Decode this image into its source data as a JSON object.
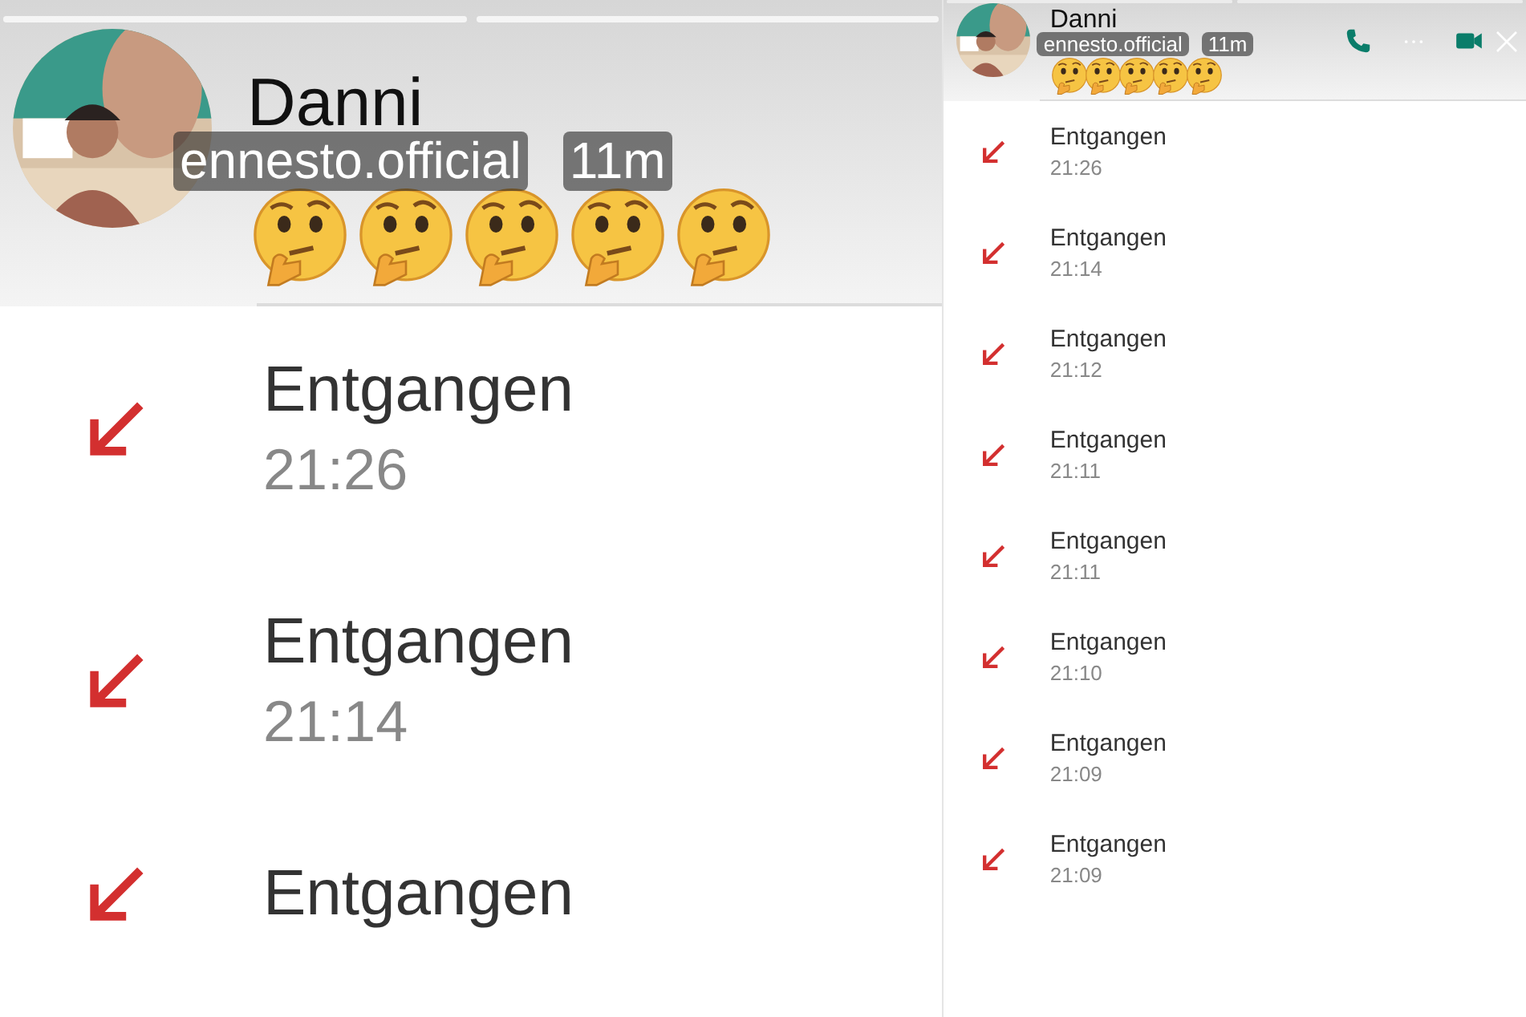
{
  "panels": [
    {
      "kind": "zoomed",
      "story_bars": [
        {
          "level": 1
        },
        {
          "level": 1
        }
      ],
      "header": {
        "name": "Danni",
        "account": "ennesto.official",
        "time_ago": "11m"
      },
      "calls": [
        {
          "label": "Entgangen",
          "time": "21:26"
        },
        {
          "label": "Entgangen",
          "time": "21:14"
        },
        {
          "label": "Entgangen"
        }
      ]
    },
    {
      "kind": "full",
      "story_bars": [
        {
          "level": 1
        },
        {
          "level": 1
        }
      ],
      "header": {
        "name": "Danni",
        "account": "ennesto.official",
        "time_ago": "11m"
      },
      "calls": [
        {
          "label": "Entgangen",
          "time": "21:26"
        },
        {
          "label": "Entgangen",
          "time": "21:14"
        },
        {
          "label": "Entgangen",
          "time": "21:12"
        },
        {
          "label": "Entgangen",
          "time": "21:11"
        },
        {
          "label": "Entgangen",
          "time": "21:11"
        },
        {
          "label": "Entgangen",
          "time": "21:10"
        },
        {
          "label": "Entgangen",
          "time": "21:09"
        },
        {
          "label": "Entgangen",
          "time": "21:09"
        }
      ]
    }
  ]
}
